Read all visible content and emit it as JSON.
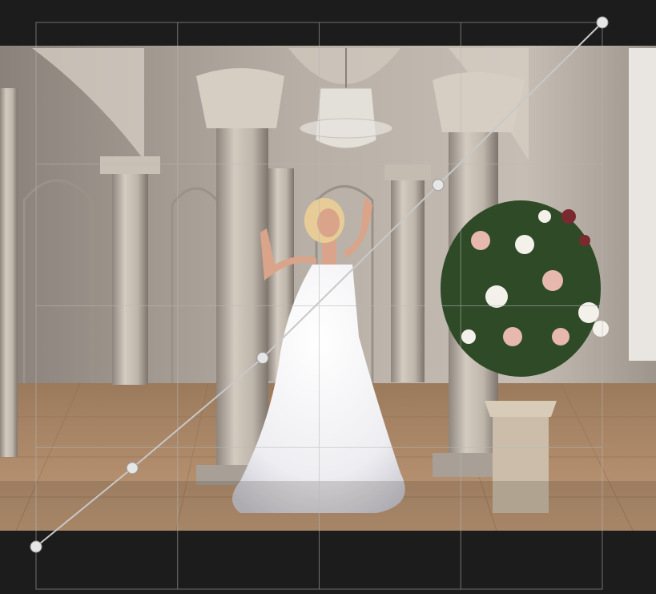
{
  "editor": {
    "tool": "tone-curve",
    "background_color": "#1c1c1c",
    "grid_divisions": 4,
    "curve_color": "#c8c8c8",
    "point_color": "#e6e6e6",
    "curve_points": [
      {
        "input": 0.0,
        "output": 0.0
      },
      {
        "input": 0.17,
        "output": 0.15
      },
      {
        "input": 0.4,
        "output": 0.36
      },
      {
        "input": 0.71,
        "output": 0.69
      },
      {
        "input": 1.0,
        "output": 1.0
      }
    ]
  },
  "photo": {
    "subject": "bride-in-white-gown",
    "setting": "classical-hall-with-columns",
    "palette": {
      "wall": "#bdb5ac",
      "wall_shadow": "#7e766f",
      "column": "#c9c1b6",
      "floor": "#b08d6c",
      "dress": "#f3f3f6",
      "hair": "#e8cc98",
      "skin": "#d9a48a",
      "flowers_green": "#2f4a27",
      "flowers_pink": "#e7b8ad"
    }
  }
}
